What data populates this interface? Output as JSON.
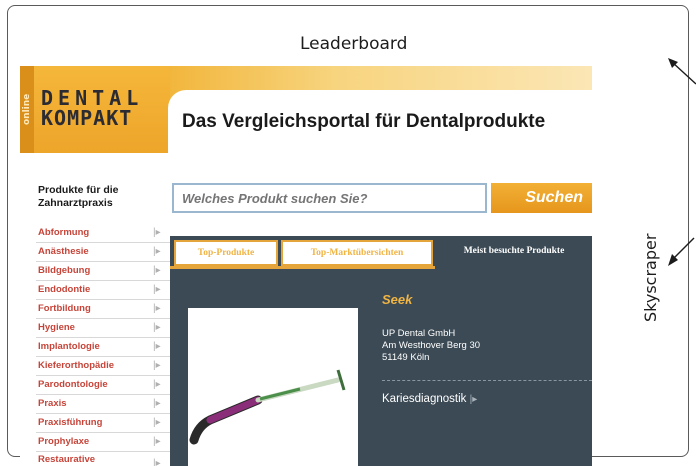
{
  "annotations": {
    "leaderboard": "Leaderboard",
    "skyscraper": "Skyscraper"
  },
  "site": {
    "logo_line1": "DENTAL",
    "logo_line2": "KOMPAKT",
    "vertical_tab": "online",
    "title": "Das Vergleichsportal für Dentalprodukte"
  },
  "sidebar": {
    "heading": "Produkte für die Zahnarztpraxis",
    "items": [
      {
        "label": "Abformung"
      },
      {
        "label": "Anästhesie"
      },
      {
        "label": "Bildgebung"
      },
      {
        "label": "Endodontie"
      },
      {
        "label": "Fortbildung"
      },
      {
        "label": "Hygiene"
      },
      {
        "label": "Implantologie"
      },
      {
        "label": "Kieferorthopädie"
      },
      {
        "label": "Parodontologie"
      },
      {
        "label": "Praxis"
      },
      {
        "label": "Praxisführung"
      },
      {
        "label": "Prophylaxe"
      },
      {
        "label": "Restaurative"
      }
    ]
  },
  "search": {
    "placeholder": "Welches Produkt suchen Sie?",
    "button": "Suchen"
  },
  "tabs": [
    {
      "label": "Top-Produkte"
    },
    {
      "label": "Top-Marktübersichten"
    },
    {
      "label": "Meist besuchte Produkte"
    }
  ],
  "product": {
    "name": "Seek",
    "company": "UP Dental GmbH",
    "street": "Am Westhover Berg 30",
    "city": "51149 Köln",
    "category": "Kariesdiagnostik"
  },
  "colors": {
    "brand_orange": "#eda52a",
    "panel_dark": "#3b4a55",
    "link_red": "#c6453a",
    "accent_yellow": "#f0b443"
  }
}
